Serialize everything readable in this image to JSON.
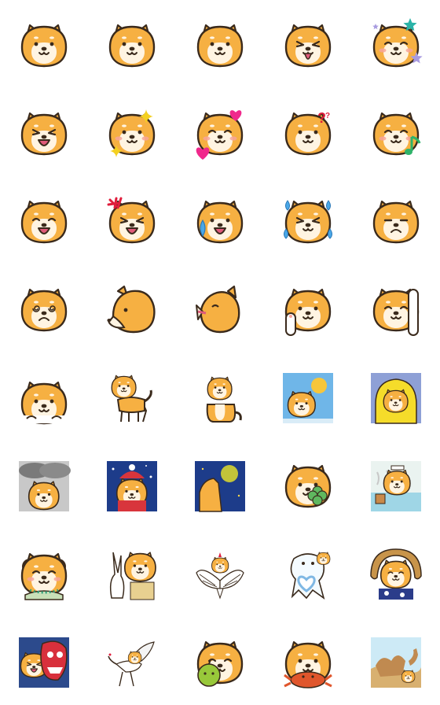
{
  "sheet": {
    "grid": {
      "columns": 5,
      "rows": 8
    },
    "palette": {
      "fur": "#f6b042",
      "fur_dark": "#e79a2c",
      "muzzle": "#fff4e2",
      "outline": "#3a2a1c",
      "blush": "#f7a59a",
      "tongue": "#e05a7a",
      "sky": "#6fb6e8",
      "night": "#1d3c8a",
      "star_teal": "#2bb3a8",
      "star_lilac": "#a89be0",
      "heart": "#f0288c",
      "sparkle": "#f4d020",
      "tear": "#4aa8e8",
      "anger": "#e01d3c",
      "note": "#2fb36a"
    },
    "emoji": [
      {
        "icon": "shiba-neutral-icon"
      },
      {
        "icon": "shiba-neutral-icon"
      },
      {
        "icon": "shiba-neutral-icon"
      },
      {
        "icon": "shiba-tongue-out-icon"
      },
      {
        "icon": "shiba-stars-icon"
      },
      {
        "icon": "shiba-big-tongue-icon"
      },
      {
        "icon": "shiba-sparkle-blush-icon"
      },
      {
        "icon": "shiba-hearts-icon"
      },
      {
        "icon": "shiba-question-icon"
      },
      {
        "icon": "shiba-music-note-icon"
      },
      {
        "icon": "shiba-crying-mouth-icon"
      },
      {
        "icon": "shiba-angry-icon"
      },
      {
        "icon": "shiba-sweat-icon"
      },
      {
        "icon": "shiba-tears-icon"
      },
      {
        "icon": "shiba-worried-icon"
      },
      {
        "icon": "shiba-dizzy-icon"
      },
      {
        "icon": "shiba-side-profile-icon"
      },
      {
        "icon": "shiba-howl-icon"
      },
      {
        "icon": "shiba-paw-wave-icon"
      },
      {
        "icon": "shiba-raise-hand-icon"
      },
      {
        "icon": "shiba-peek-icon"
      },
      {
        "icon": "shiba-standing-icon"
      },
      {
        "icon": "shiba-sitting-icon"
      },
      {
        "icon": "shiba-sunny-icon"
      },
      {
        "icon": "shiba-raincoat-icon"
      },
      {
        "icon": "shiba-cloudy-icon"
      },
      {
        "icon": "shiba-winter-hat-icon"
      },
      {
        "icon": "shiba-moon-night-icon"
      },
      {
        "icon": "shiba-clover-icon"
      },
      {
        "icon": "shiba-hot-spring-icon"
      },
      {
        "icon": "shiba-princess-icon"
      },
      {
        "icon": "shiba-rabbit-friend-icon"
      },
      {
        "icon": "shiba-angel-wings-icon"
      },
      {
        "icon": "shiba-heart-ghost-icon"
      },
      {
        "icon": "shiba-straw-hat-icon"
      },
      {
        "icon": "shiba-demon-mask-icon"
      },
      {
        "icon": "shiba-crane-icon"
      },
      {
        "icon": "shiba-green-apple-icon"
      },
      {
        "icon": "shiba-crab-icon"
      },
      {
        "icon": "shiba-camel-desert-icon"
      }
    ]
  }
}
